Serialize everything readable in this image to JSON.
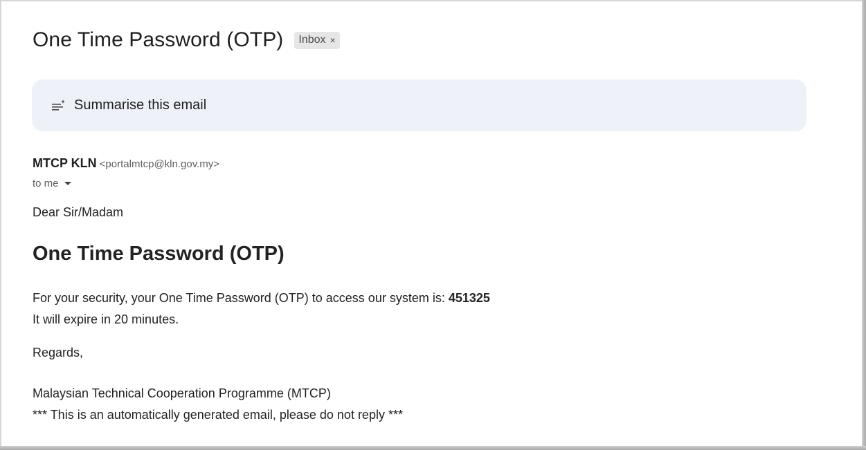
{
  "email": {
    "subject": "One Time Password (OTP)",
    "label": {
      "name": "Inbox",
      "remove_glyph": "×"
    },
    "summarise_label": "Summarise this email",
    "sender_name": "MTCP KLN",
    "sender_email": "<portalmtcp@kln.gov.my>",
    "recipient": "to me",
    "body": {
      "greeting": "Dear Sir/Madam",
      "heading": "One Time Password (OTP)",
      "otp_prefix": "For your security, your One Time Password (OTP) to access our system is:",
      "otp_code": "451325",
      "expiry": "It will expire in 20 minutes.",
      "regards": "Regards,",
      "organisation": "Malaysian Technical Cooperation Programme (MTCP)",
      "notice": "*** This is an automatically generated email, please do not reply ***"
    }
  },
  "icons": {
    "summarise": "sparkle-list-icon",
    "recipient_dropdown": "caret-down-icon",
    "label_remove": "close-icon"
  },
  "colors": {
    "summarise_bg": "#eef2f8",
    "chip_bg": "#e6e6e6",
    "text_primary": "#1f1f1f",
    "text_secondary": "#5e5e5e"
  }
}
